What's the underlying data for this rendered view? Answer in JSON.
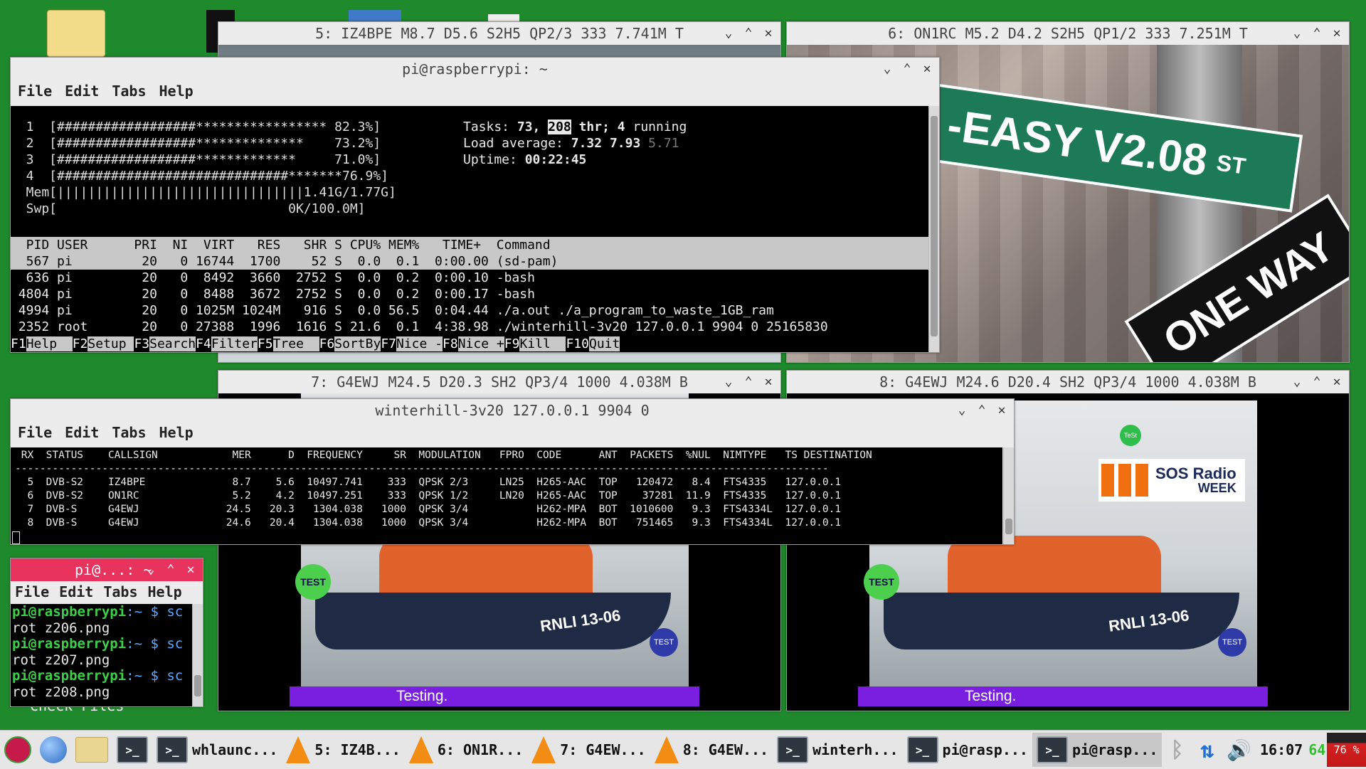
{
  "windows": {
    "vid5": {
      "title": "5: IZ4BPE M8.7 D5.6 S2H5 QP2/3 333 7.741M T"
    },
    "vid6": {
      "title": "6: ON1RC M5.2 D4.2 S2H5 QP1/2 333 7.251M T",
      "sign_text": "-EASY V2.08",
      "sign_suffix": "ST",
      "oneway_text": "ONE WAY"
    },
    "vid7": {
      "title": "7: G4EWJ M24.5 D20.3 SH2 QP3/4 1000 4.038M B",
      "caption": "Testing.",
      "hull_text": "RNLI 13-06",
      "badge_test": "TEST"
    },
    "vid8": {
      "title": "8: G4EWJ M24.6 D20.4 SH2 QP3/4 1000 4.038M B",
      "caption": "Testing.",
      "hull_text": "RNLI 13-06",
      "badge_test": "TEST",
      "sos_logo": "SOS Radio",
      "sos_week": "WEEK",
      "badge_small": "TeSt"
    }
  },
  "htop": {
    "title": "pi@raspberrypi: ~",
    "menu": [
      "File",
      "Edit",
      "Tabs",
      "Help"
    ],
    "cpu_lines": [
      "  1  [##################***************** 82.3%]",
      "  2  [##################**************    73.2%]",
      "  3  [##################*************     71.0%]",
      "  4  [##############################*******76.9%]",
      "  Mem[||||||||||||||||||||||||||||||||1.41G/1.77G]",
      "  Swp[                              0K/100.0M]"
    ],
    "stats": {
      "tasks_label": "Tasks:",
      "tasks_value": "73,",
      "thr_value": "208",
      "thr_label": "thr;",
      "running": "4",
      "running_label": "running",
      "load_label": "Load average:",
      "load1": "7.32",
      "load5": "7.93",
      "load15": "5.71",
      "uptime_label": "Uptime:",
      "uptime_value": "00:22:45"
    },
    "header": "  PID USER      PRI  NI  VIRT   RES   SHR S CPU% MEM%   TIME+  Command",
    "rows": [
      "  567 pi         20   0 16744  1700    52 S  0.0  0.1  0:00.00 (sd-pam)",
      "  636 pi         20   0  8492  3660  2752 S  0.0  0.2  0:00.10 -bash",
      " 4804 pi         20   0  8488  3672  2752 S  0.0  0.2  0:00.17 -bash",
      " 4994 pi         20   0 1025M 1024M   916 S  0.0 56.5  0:04.44 ./a.out ./a_program_to_waste_1GB_ram",
      " 2352 root       20   0 27388  1996  1616 S 21.6  0.1  4:38.98 ./winterhill-3v20 127.0.0.1 9904 0 25165830"
    ],
    "fkeys": [
      {
        "key": "F1",
        "label": "Help  "
      },
      {
        "key": "F2",
        "label": "Setup "
      },
      {
        "key": "F3",
        "label": "Search"
      },
      {
        "key": "F4",
        "label": "Filter"
      },
      {
        "key": "F5",
        "label": "Tree  "
      },
      {
        "key": "F6",
        "label": "SortBy"
      },
      {
        "key": "F7",
        "label": "Nice -"
      },
      {
        "key": "F8",
        "label": "Nice +"
      },
      {
        "key": "F9",
        "label": "Kill  "
      },
      {
        "key": "F10",
        "label": "Quit"
      }
    ]
  },
  "winterhill": {
    "title": "winterhill-3v20 127.0.0.1 9904 0",
    "menu": [
      "File",
      "Edit",
      "Tabs",
      "Help"
    ],
    "header": " RX  STATUS    CALLSIGN            MER      D  FREQUENCY     SR  MODULATION   FPRO  CODE      ANT  PACKETS  %NUL  NIMTYPE   TS DESTINATION",
    "divider": "-----------------------------------------------------------------------------------------------------------------------------------",
    "rows": [
      "  5  DVB-S2    IZ4BPE              8.7    5.6  10497.741    333  QPSK 2/3     LN25  H265-AAC  TOP   120472   8.4  FTS4335   127.0.0.1",
      "  6  DVB-S2    ON1RC               5.2    4.2  10497.251    333  QPSK 1/2     LN20  H265-AAC  TOP    37281  11.9  FTS4335   127.0.0.1",
      "  7  DVB-S     G4EWJ              24.5   20.3   1304.038   1000  QPSK 3/4           H262-MPA  BOT  1010600   9.3  FTS4334L  127.0.0.1",
      "  8  DVB-S     G4EWJ              24.6   20.4   1304.038   1000  QPSK 3/4           H262-MPA  BOT   751465   9.3  FTS4334L  127.0.0.1"
    ]
  },
  "small_term": {
    "title": "pi@...: ~",
    "menu": [
      "File",
      "Edit",
      "Tabs",
      "Help"
    ],
    "prompt_user": "pi@raspberrypi",
    "prompt_rest": ":~ $ sc",
    "lines": [
      "rot z206.png",
      "rot z207.png",
      "rot z208.png"
    ]
  },
  "desktop": {
    "check_files": "Check Files"
  },
  "taskbar": {
    "items": [
      {
        "label": "whlaunc..."
      },
      {
        "label": "5: IZ4B..."
      },
      {
        "label": "6: ON1R..."
      },
      {
        "label": "7: G4EW..."
      },
      {
        "label": "8: G4EW..."
      },
      {
        "label": "winterh..."
      },
      {
        "label": "pi@rasp..."
      },
      {
        "label": "pi@rasp..."
      }
    ],
    "clock": "16:07",
    "temp": "64",
    "cpu_percent": "76 %",
    "term_glyph": ">_"
  }
}
